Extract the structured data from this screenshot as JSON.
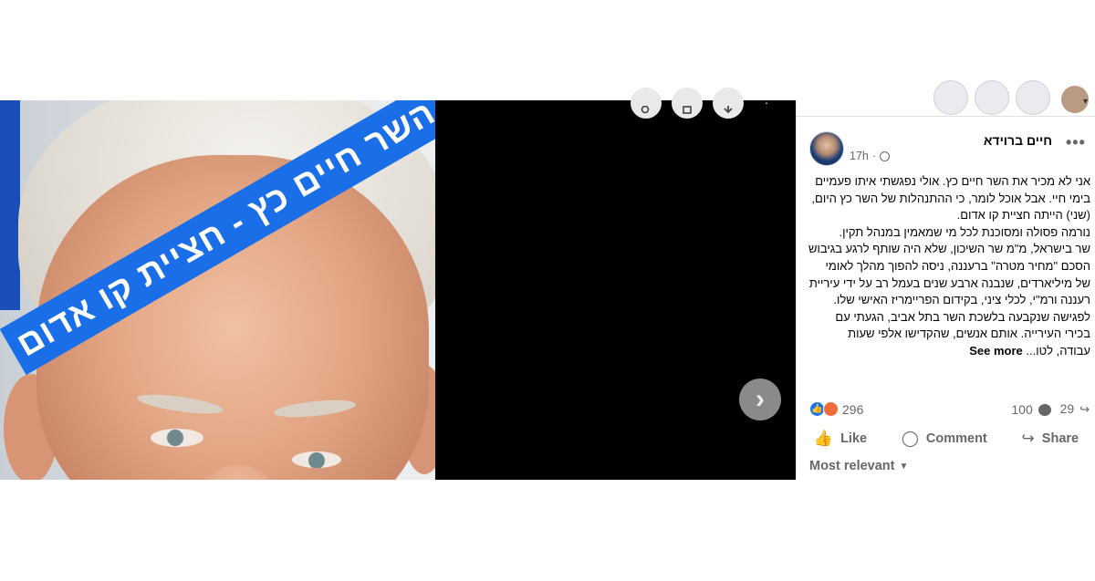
{
  "photo": {
    "banner_text": "השר חיים כץ - חציית קו אדום"
  },
  "viewer": {
    "top_icons": [
      "zoom-icon",
      "tag-icon",
      "download-icon"
    ],
    "next_icon": "chevron-right-icon",
    "next_glyph": "›"
  },
  "post": {
    "author": "חיים ברוידא",
    "time": "17h",
    "more_glyph": "•••",
    "paragraphs": [
      "אני לא מכיר את השר חיים כץ. אולי נפגשתי איתו פעמיים בימי חיי. אבל אוכל לומר, כי ההתנהלות של השר כץ היום, (שני) הייתה חציית קו אדום.",
      "נורמה פסולה ומסוכנת לכל מי שמאמין במנהל תקין.",
      "שר בישראל, מ\"מ שר השיכון, שלא היה שותף לרגע בגיבוש הסכם \"מחיר מטרה\" ברעננה, ניסה להפוך מהלך לאומי של מיליארדים, שנבנה ארבע שנים בעמל רב על ידי עיריית רעננה ורמ\"י, לכלי ציני, בקידום הפריימריז האישי שלו.",
      "לפגישה שנקבעה בלשכת השר בתל אביב, הגעתי עם בכירי העירייה. אותם אנשים, שהקדישו אלפי שעות"
    ],
    "last_line": "עבודה, לטו...",
    "see_more": "See more"
  },
  "stats": {
    "reactions_count": "296",
    "comments_count": "100",
    "shares_count": "29"
  },
  "actions": {
    "like": "Like",
    "comment": "Comment",
    "share": "Share",
    "like_glyph": "👍",
    "comment_glyph": "◯",
    "share_glyph": "↪"
  },
  "sort": {
    "label": "Most relevant",
    "caret": "▼"
  },
  "colors": {
    "banner": "#1a6fe8",
    "viewer_bg": "#000000",
    "like_blue": "#1877f2",
    "angry_orange": "#f26b3a"
  }
}
